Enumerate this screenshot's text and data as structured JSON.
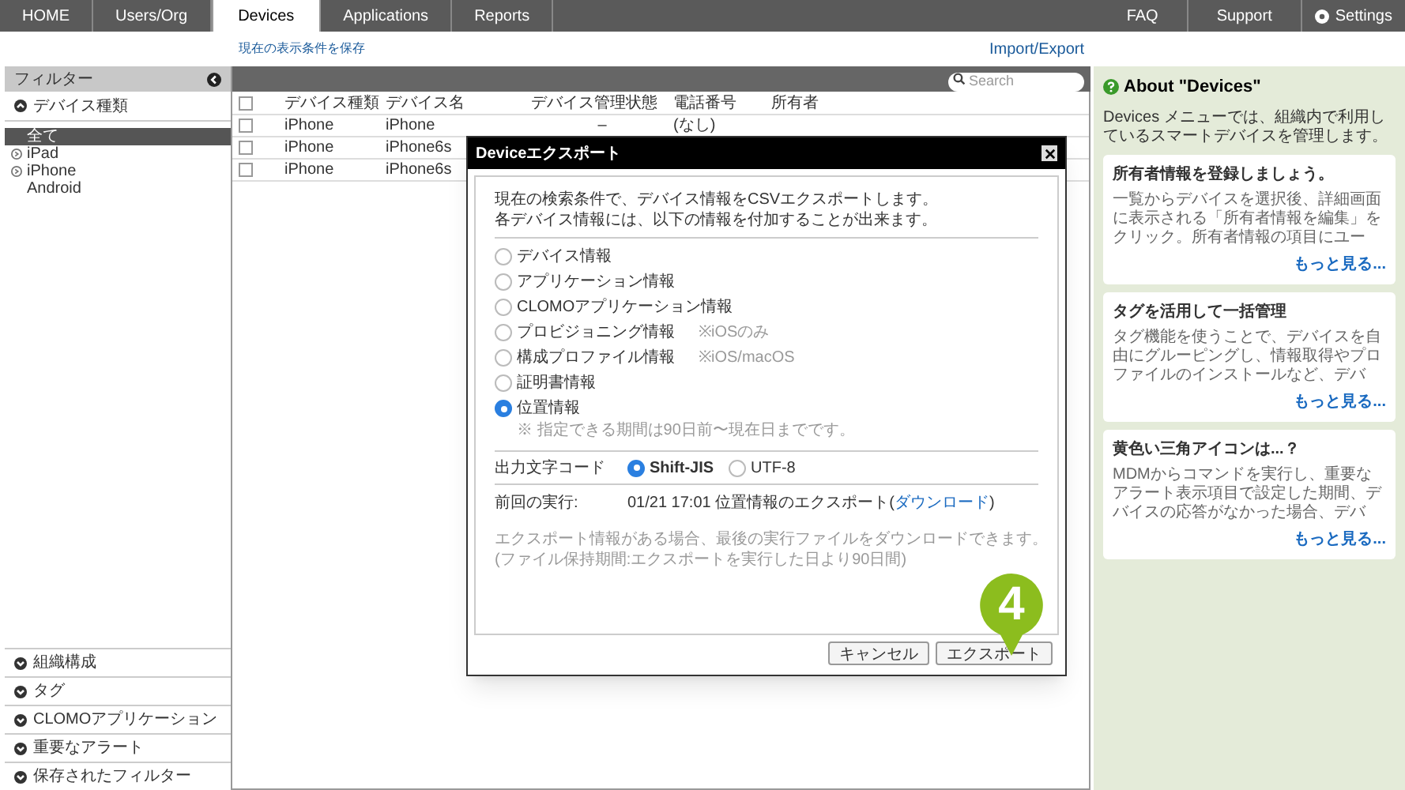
{
  "nav": {
    "tabs": [
      {
        "label": "HOME",
        "selected": false
      },
      {
        "label": "Users/Org",
        "selected": false
      },
      {
        "label": "Devices",
        "selected": true
      },
      {
        "label": "Applications",
        "selected": false
      },
      {
        "label": "Reports",
        "selected": false
      }
    ],
    "right_items": [
      {
        "label": "FAQ",
        "kind": "link"
      },
      {
        "label": "Support",
        "kind": "link"
      },
      {
        "label": "Settings",
        "kind": "settings"
      }
    ]
  },
  "toolbar": {
    "save_link": "現在の表示条件を保存",
    "import_export": "Import/Export"
  },
  "filter_panel": {
    "title": "フィルター",
    "device_types": {
      "label": "デバイス種類",
      "expanded": true,
      "items": [
        {
          "label": "全て",
          "selected": true,
          "kind": "leaf"
        },
        {
          "label": "iPad",
          "selected": false,
          "kind": "group"
        },
        {
          "label": "iPhone",
          "selected": false,
          "kind": "group"
        },
        {
          "label": "Android",
          "selected": false,
          "kind": "leaf"
        }
      ]
    },
    "sections": [
      {
        "label": "組織構成",
        "expanded": false
      },
      {
        "label": "タグ",
        "expanded": false
      },
      {
        "label": "CLOMOアプリケーション",
        "expanded": false
      },
      {
        "label": "重要なアラート",
        "expanded": false
      },
      {
        "label": "保存されたフィルター",
        "expanded": false
      }
    ]
  },
  "table": {
    "search": {
      "placeholder": "Search"
    },
    "select_all_checked": false,
    "columns": [
      "デバイス種類",
      "デバイス名",
      "デバイス管理状態",
      "電話番号",
      "所有者"
    ],
    "rows": [
      {
        "selected": false,
        "cells": [
          "iPhone",
          "iPhone",
          "–",
          "(なし)"
        ]
      },
      {
        "selected": false,
        "cells": [
          "iPhone",
          "iPhone6s"
        ]
      },
      {
        "selected": false,
        "cells": [
          "iPhone",
          "iPhone6s"
        ]
      }
    ]
  },
  "dialog": {
    "title": "Deviceエクスポート",
    "intro": [
      "現在の検索条件で、デバイス情報をCSVエクスポートします。",
      "各デバイス情報には、以下の情報を付加することが出来ます。"
    ],
    "options": [
      {
        "label": "デバイス情報",
        "selected": false
      },
      {
        "label": "アプリケーション情報",
        "selected": false
      },
      {
        "label": "CLOMOアプリケーション情報",
        "selected": false
      },
      {
        "label": "プロビジョニング情報",
        "note": "※iOSのみ",
        "selected": false
      },
      {
        "label": "構成プロファイル情報",
        "note": "※iOS/macOS",
        "selected": false
      },
      {
        "label": "証明書情報",
        "selected": false
      },
      {
        "label": "位置情報",
        "hint": "※ 指定できる期間は90日前〜現在日までです。",
        "selected": true
      }
    ],
    "encoding": {
      "label": "出力文字コード",
      "options": [
        {
          "label": "Shift-JIS",
          "selected": true
        },
        {
          "label": "UTF-8",
          "selected": false
        }
      ]
    },
    "last_run": {
      "label": "前回の実行:",
      "text": "01/21 17:01 位置情報のエクスポート(",
      "link": "ダウンロード",
      "suffix": ")"
    },
    "info": [
      "エクスポート情報がある場合、最後の実行ファイルをダウンロードできます。",
      "(ファイル保持期間:エクスポートを実行した日より90日間)"
    ],
    "buttons": {
      "cancel": "キャンセル",
      "export": "エクスポート"
    },
    "callout": "4"
  },
  "help": {
    "title": "About \"Devices\"",
    "intro": "Devices メニューでは、組織内で利用しているスマートデバイスを管理します。",
    "cards": [
      {
        "title": "所有者情報を登録しましょう。",
        "body": "一覧からデバイスを選択後、詳細画面に表示される「所有者情報を編集」をクリック。所有者情報の項目にユー",
        "more": "もっと見る..."
      },
      {
        "title": "タグを活用して一括管理",
        "body": "タグ機能を使うことで、デバイスを自由にグルーピングし、情報取得やプロファイルのインストールなど、デバ",
        "more": "もっと見る..."
      },
      {
        "title": "黄色い三角アイコンは...？",
        "body": "MDMからコマンドを実行し、重要なアラート表示項目で設定した期間、デバイスの応答がなかった場合、デバ",
        "more": "もっと見る..."
      }
    ]
  }
}
